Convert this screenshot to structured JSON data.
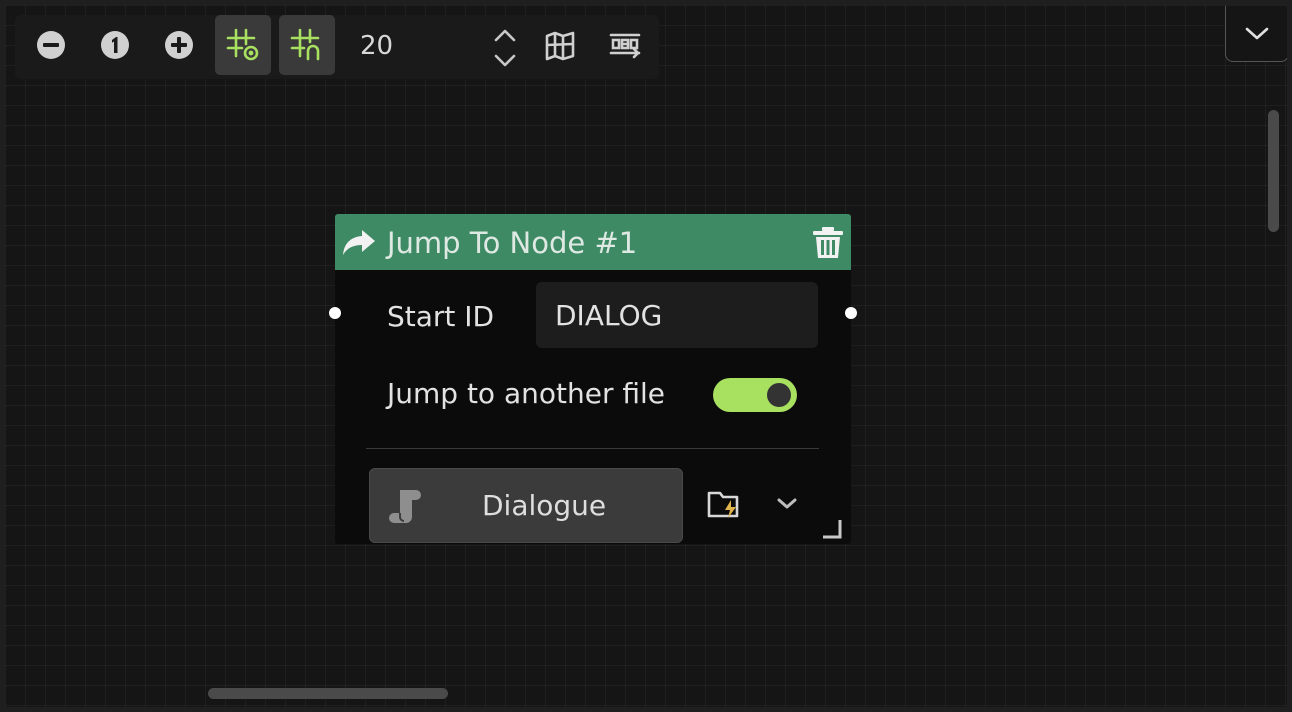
{
  "toolbar": {
    "zoom_out_icon": "minus-circle-icon",
    "reset_zoom_icon": "one-circle-icon",
    "zoom_in_icon": "plus-circle-icon",
    "show_grid_icon": "grid-eye-icon",
    "snap_grid_icon": "grid-magnet-icon",
    "grid_size": "20",
    "minimap_icon": "map-icon",
    "arrange_icon": "arrange-icon",
    "accent": "#a8e060"
  },
  "node": {
    "title": "Jump To Node #1",
    "header_color": "#3e8a65",
    "start_id_label": "Start ID",
    "start_id_value": "DIALOG",
    "jump_file_label": "Jump to another file",
    "jump_file_enabled": true,
    "file_name": "Dialogue"
  }
}
